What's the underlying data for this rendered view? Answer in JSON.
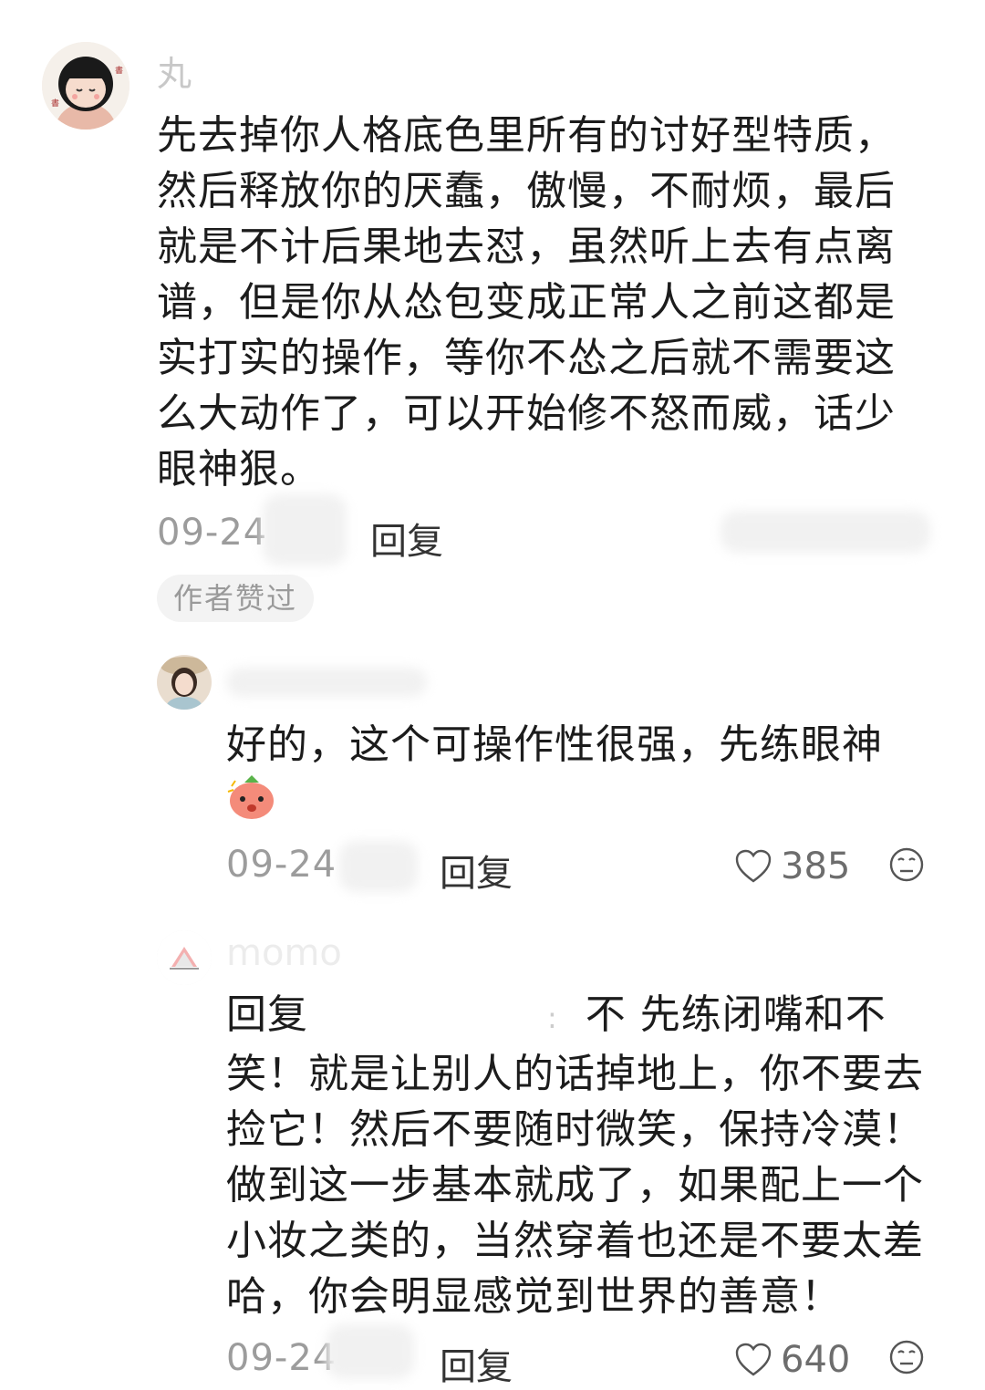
{
  "comments": [
    {
      "username": "丸",
      "text": "先去掉你人格底色里所有的讨好型特质，然后释放你的厌蠢，傲慢，不耐烦，最后就是不计后果地去怼，虽然听上去有点离谱，但是你从怂包变成正常人之前这都是实打实的操作，等你不怂之后就不需要这么大动作了，可以开始修不怒而威，话少眼神狠。",
      "date": "09-24",
      "reply_label": "回复",
      "badge": "作者赞过"
    },
    {
      "username": "",
      "text": "好的，这个可操作性很强，先练眼神",
      "emoji": "emoji-face-icon",
      "date": "09-24",
      "reply_label": "回复",
      "likes": "385"
    },
    {
      "username": "momo",
      "reply_prefix": "回复",
      "reply_colon": ":",
      "text": "不 先练闭嘴和不笑！就是让别人的话掉地上，你不要去捡它！然后不要随时微笑，保持冷漠！做到这一步基本就成了，如果配上一个小妆之类的，当然穿着也还是不要太差哈，你会明显感觉到世界的善意！",
      "date": "09-24",
      "reply_label": "回复",
      "likes": "640"
    }
  ],
  "icons": {
    "like": "heart-outline-icon",
    "dislike": "meh-face-icon"
  },
  "colors": {
    "text": "#1c1c1c",
    "meta": "#9c9c9c",
    "badge_bg": "#f3f3f3"
  }
}
